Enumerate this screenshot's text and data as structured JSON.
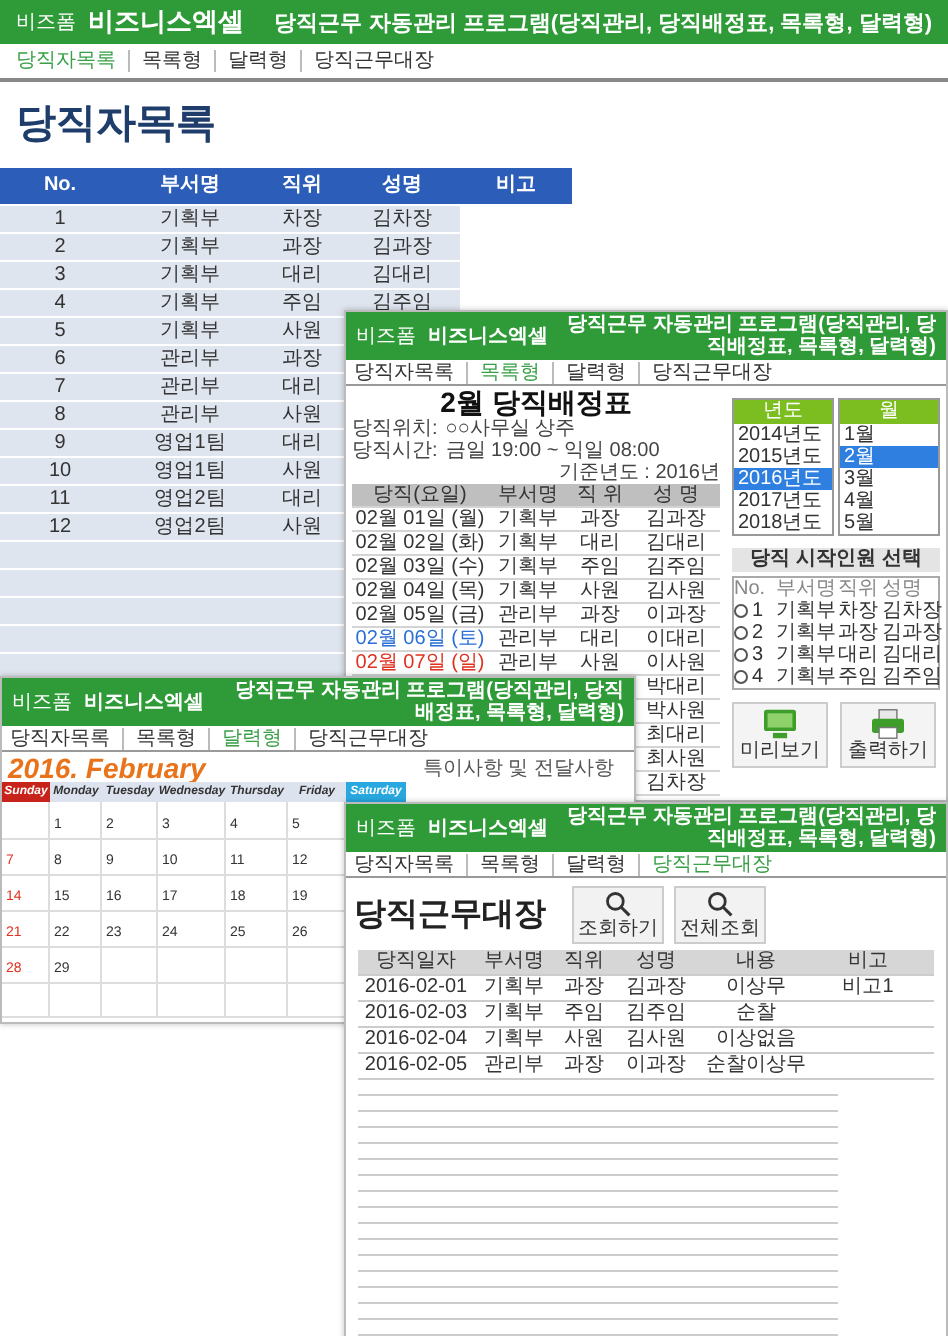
{
  "main": {
    "header": {
      "brand_small": "비즈폼",
      "brand": "비즈니스엑셀",
      "title": "당직근무 자동관리 프로그램(당직관리, 당직배정표, 목록형, 달력형)"
    },
    "nav": [
      {
        "label": "당직자목록",
        "selected": true
      },
      {
        "label": "목록형",
        "selected": false
      },
      {
        "label": "달력형",
        "selected": false
      },
      {
        "label": "당직근무대장",
        "selected": false
      }
    ],
    "title": "당직자목록",
    "table": {
      "columns": [
        "No.",
        "부서명",
        "직위",
        "성명",
        "비고"
      ],
      "rows": [
        {
          "no": "1",
          "dept": "기획부",
          "position": "차장",
          "name": "김차장"
        },
        {
          "no": "2",
          "dept": "기획부",
          "position": "과장",
          "name": "김과장"
        },
        {
          "no": "3",
          "dept": "기획부",
          "position": "대리",
          "name": "김대리"
        },
        {
          "no": "4",
          "dept": "기획부",
          "position": "주임",
          "name": "김주임"
        },
        {
          "no": "5",
          "dept": "기획부",
          "position": "사원"
        },
        {
          "no": "6",
          "dept": "관리부",
          "position": "과장"
        },
        {
          "no": "7",
          "dept": "관리부",
          "position": "대리"
        },
        {
          "no": "8",
          "dept": "관리부",
          "position": "사원"
        },
        {
          "no": "9",
          "dept": "영업1팀",
          "position": "대리"
        },
        {
          "no": "10",
          "dept": "영업1팀",
          "position": "사원"
        },
        {
          "no": "11",
          "dept": "영업2팀",
          "position": "대리"
        },
        {
          "no": "12",
          "dept": "영업2팀",
          "position": "사원"
        }
      ]
    }
  },
  "roster_window": {
    "header": {
      "brand_small": "비즈폼",
      "brand": "비즈니스엑셀",
      "title": "당직근무 자동관리 프로그램(당직관리, 당직배정표, 목록형, 달력형)"
    },
    "nav": [
      {
        "label": "당직자목록",
        "selected": false
      },
      {
        "label": "목록형",
        "selected": true
      },
      {
        "label": "달력형",
        "selected": false
      },
      {
        "label": "당직근무대장",
        "selected": false
      }
    ],
    "title": "2월 당직배정표",
    "location_label": "당직위치:",
    "location": "○○사무실 상주",
    "time_label": "당직시간:",
    "time": "금일 19:00 ~ 익일 08:00",
    "base_year": "기준년도 : 2016년",
    "table": {
      "columns": [
        "당직(요일)",
        "부서명",
        "직 위",
        "성 명"
      ],
      "rows": [
        {
          "date": "02월 01일 (월)",
          "color": "#333333",
          "dept": "기획부",
          "position": "과장",
          "name": "김과장"
        },
        {
          "date": "02월 02일 (화)",
          "color": "#333333",
          "dept": "기획부",
          "position": "대리",
          "name": "김대리"
        },
        {
          "date": "02월 03일 (수)",
          "color": "#333333",
          "dept": "기획부",
          "position": "주임",
          "name": "김주임"
        },
        {
          "date": "02월 04일 (목)",
          "color": "#333333",
          "dept": "기획부",
          "position": "사원",
          "name": "김사원"
        },
        {
          "date": "02월 05일 (금)",
          "color": "#333333",
          "dept": "관리부",
          "position": "과장",
          "name": "이과장"
        },
        {
          "date": "02월 06일 (토)",
          "color": "#2a6fd6",
          "dept": "관리부",
          "position": "대리",
          "name": "이대리"
        },
        {
          "date": "02월 07일 (일)",
          "color": "#e0301e",
          "dept": "관리부",
          "position": "사원",
          "name": "이사원"
        },
        {
          "name": "박대리"
        },
        {
          "name": "박사원"
        },
        {
          "name": "최대리"
        },
        {
          "name": "최사원"
        },
        {
          "name": "김차장"
        }
      ]
    },
    "year_list": {
      "heading": "년도",
      "items": [
        {
          "label": "2014년도",
          "selected": false
        },
        {
          "label": "2015년도",
          "selected": false
        },
        {
          "label": "2016년도",
          "selected": true
        },
        {
          "label": "2017년도",
          "selected": false
        },
        {
          "label": "2018년도",
          "selected": false
        }
      ]
    },
    "month_list": {
      "heading": "월",
      "items": [
        {
          "label": "1월",
          "selected": false
        },
        {
          "label": "2월",
          "selected": true
        },
        {
          "label": "3월",
          "selected": false
        },
        {
          "label": "4월",
          "selected": false
        },
        {
          "label": "5월",
          "selected": false
        }
      ]
    },
    "start_person": {
      "label": "당직 시작인원 선택",
      "columns": [
        "No.",
        "부서명",
        "직위",
        "성명"
      ],
      "rows": [
        {
          "no": "1",
          "dept": "기획부",
          "position": "차장",
          "name": "김차장",
          "selected": false
        },
        {
          "no": "2",
          "dept": "기획부",
          "position": "과장",
          "name": "김과장",
          "selected": false
        },
        {
          "no": "3",
          "dept": "기획부",
          "position": "대리",
          "name": "김대리",
          "selected": false
        },
        {
          "no": "4",
          "dept": "기획부",
          "position": "주임",
          "name": "김주임",
          "selected": false
        }
      ]
    },
    "buttons": [
      {
        "label": "미리보기",
        "kind": "preview"
      },
      {
        "label": "출력하기",
        "kind": "print"
      }
    ]
  },
  "calendar_window": {
    "header": {
      "brand_small": "비즈폼",
      "brand": "비즈니스엑셀",
      "title": "당직근무 자동관리 프로그램(당직관리, 당직배정표, 목록형, 달력형)"
    },
    "nav": [
      {
        "label": "당직자목록",
        "selected": false
      },
      {
        "label": "목록형",
        "selected": false
      },
      {
        "label": "달력형",
        "selected": true
      },
      {
        "label": "당직근무대장",
        "selected": false
      }
    ],
    "title": "2016. February",
    "note": "특이사항 및 전달사항",
    "weekdays": [
      {
        "label": "Sunday",
        "kind": "sunday"
      },
      {
        "label": "Monday",
        "kind": "weekday"
      },
      {
        "label": "Tuesday",
        "kind": "weekday"
      },
      {
        "label": "Wednesday",
        "kind": "weekday"
      },
      {
        "label": "Thursday",
        "kind": "weekday"
      },
      {
        "label": "Friday",
        "kind": "weekday"
      },
      {
        "label": "Saturday",
        "kind": "saturday"
      }
    ],
    "weeks": [
      [
        {
          "kind": "blank"
        },
        {
          "day": "1",
          "kind": "weekday"
        },
        {
          "day": "2",
          "kind": "weekday"
        },
        {
          "day": "3",
          "kind": "weekday"
        },
        {
          "day": "4",
          "kind": "weekday"
        },
        {
          "day": "5",
          "kind": "weekday"
        }
      ],
      [
        {
          "day": "7",
          "kind": "sunday"
        },
        {
          "day": "8",
          "kind": "weekday"
        },
        {
          "day": "9",
          "kind": "weekday"
        },
        {
          "day": "10",
          "kind": "weekday"
        },
        {
          "day": "11",
          "kind": "weekday"
        },
        {
          "day": "12",
          "kind": "weekday"
        }
      ],
      [
        {
          "day": "14",
          "kind": "sunday"
        },
        {
          "day": "15",
          "kind": "weekday"
        },
        {
          "day": "16",
          "kind": "weekday"
        },
        {
          "day": "17",
          "kind": "weekday"
        },
        {
          "day": "18",
          "kind": "weekday"
        },
        {
          "day": "19",
          "kind": "weekday"
        }
      ],
      [
        {
          "day": "21",
          "kind": "sunday"
        },
        {
          "day": "22",
          "kind": "weekday"
        },
        {
          "day": "23",
          "kind": "weekday"
        },
        {
          "day": "24",
          "kind": "weekday"
        },
        {
          "day": "25",
          "kind": "weekday"
        },
        {
          "day": "26",
          "kind": "weekday"
        }
      ],
      [
        {
          "day": "28",
          "kind": "sunday"
        },
        {
          "day": "29",
          "kind": "weekday"
        },
        {
          "kind": "blank"
        },
        {
          "kind": "blank"
        },
        {
          "kind": "blank"
        },
        {
          "kind": "blank"
        }
      ],
      [
        {
          "kind": "blank"
        },
        {
          "kind": "blank"
        },
        {
          "kind": "blank"
        },
        {
          "kind": "blank"
        },
        {
          "kind": "blank"
        },
        {
          "kind": "blank"
        }
      ]
    ]
  },
  "ledger_window": {
    "header": {
      "brand_small": "비즈폼",
      "brand": "비즈니스엑셀",
      "title": "당직근무 자동관리 프로그램(당직관리, 당직배정표, 목록형, 달력형)"
    },
    "nav": [
      {
        "label": "당직자목록",
        "selected": false
      },
      {
        "label": "목록형",
        "selected": false
      },
      {
        "label": "달력형",
        "selected": false
      },
      {
        "label": "당직근무대장",
        "selected": true
      }
    ],
    "title": "당직근무대장",
    "buttons": [
      {
        "label": "조회하기"
      },
      {
        "label": "전체조회"
      }
    ],
    "table": {
      "columns": [
        "당직일자",
        "부서명",
        "직위",
        "성명",
        "내용",
        "비고"
      ],
      "rows": [
        [
          "2016-02-01",
          "기획부",
          "과장",
          "김과장",
          "이상무",
          "비고1"
        ],
        [
          "2016-02-03",
          "기획부",
          "주임",
          "김주임",
          "순찰"
        ],
        [
          "2016-02-04",
          "기획부",
          "사원",
          "김사원",
          "이상없음"
        ],
        [
          "2016-02-05",
          "관리부",
          "과장",
          "이과장",
          "순찰이상무"
        ]
      ]
    }
  }
}
